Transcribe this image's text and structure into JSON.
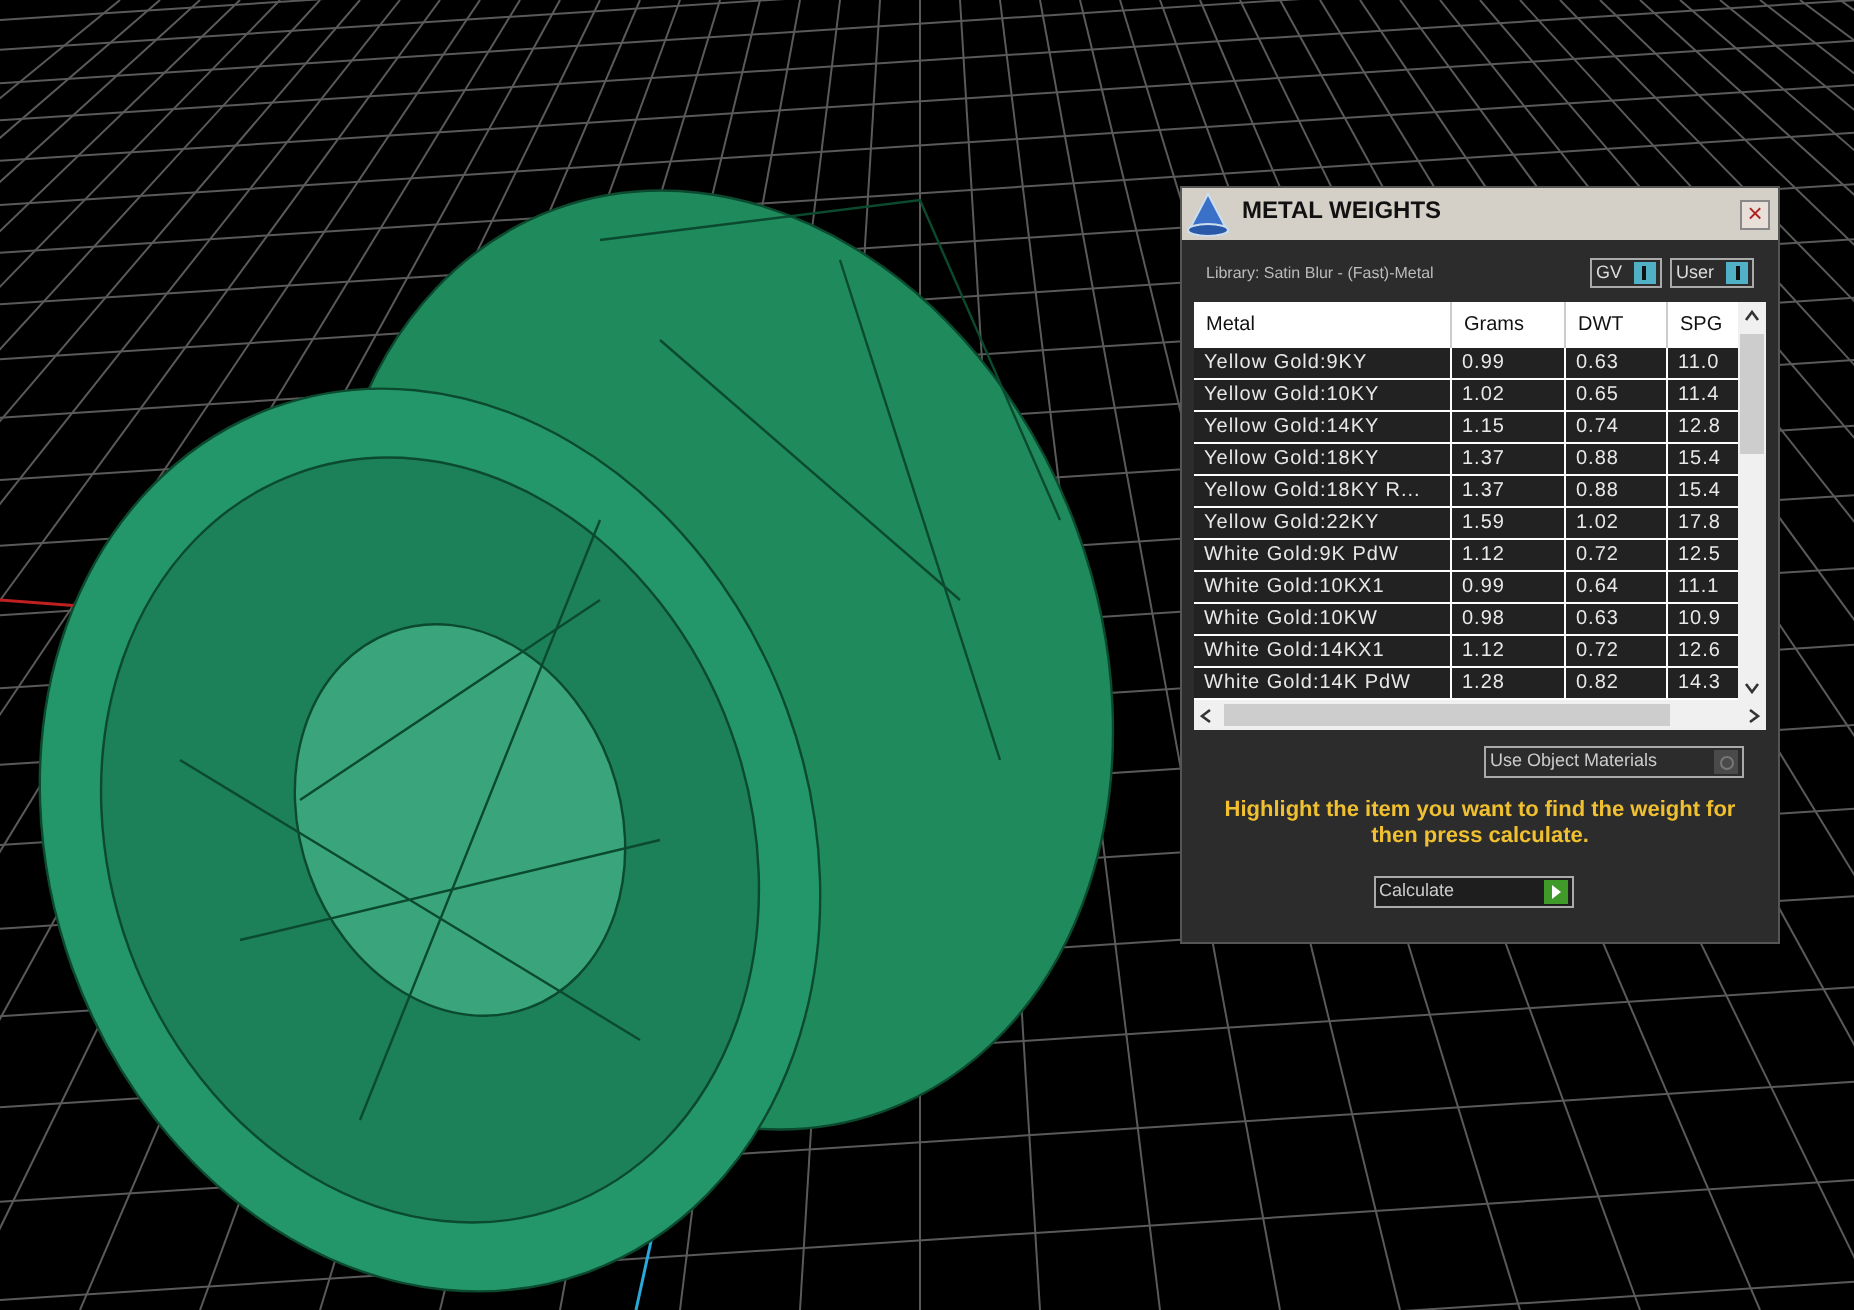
{
  "panel": {
    "title": "METAL WEIGHTS",
    "close": "×",
    "library": "Library: Satin Blur - (Fast)-Metal",
    "toggles": [
      {
        "label": "GV",
        "on": true
      },
      {
        "label": "User",
        "on": true
      }
    ],
    "table": {
      "columns": [
        "Metal",
        "Grams",
        "DWT",
        "SPG"
      ],
      "rows": [
        {
          "cells": [
            "Yellow Gold:9KY",
            "0.99",
            "0.63",
            "11.0"
          ],
          "selected": false
        },
        {
          "cells": [
            "Yellow Gold:10KY",
            "1.02",
            "0.65",
            "11.4"
          ],
          "selected": false
        },
        {
          "cells": [
            "Yellow Gold:14KY",
            "1.15",
            "0.74",
            "12.8"
          ],
          "selected": false
        },
        {
          "cells": [
            "Yellow Gold:18KY",
            "1.37",
            "0.88",
            "15.4"
          ],
          "selected": false
        },
        {
          "cells": [
            "Yellow Gold:18KY R...",
            "1.37",
            "0.88",
            "15.4"
          ],
          "selected": false
        },
        {
          "cells": [
            "Yellow Gold:22KY",
            "1.59",
            "1.02",
            "17.8"
          ],
          "selected": false
        },
        {
          "cells": [
            "White Gold:9K PdW",
            "1.12",
            "0.72",
            "12.5"
          ],
          "selected": false
        },
        {
          "cells": [
            "White Gold:10KX1",
            "0.99",
            "0.64",
            "11.1"
          ],
          "selected": false
        },
        {
          "cells": [
            "White Gold:10KW",
            "0.98",
            "0.63",
            "10.9"
          ],
          "selected": false
        },
        {
          "cells": [
            "White Gold:14KX1",
            "1.12",
            "0.72",
            "12.6"
          ],
          "selected": false
        },
        {
          "cells": [
            "White Gold:14K PdW",
            "1.28",
            "0.82",
            "14.3"
          ],
          "selected": false
        }
      ]
    },
    "option": {
      "label": "Use Object Materials",
      "checked": false
    },
    "hint": "Highlight the item you want to find the weight for then press calculate.",
    "button": "Calculate"
  }
}
